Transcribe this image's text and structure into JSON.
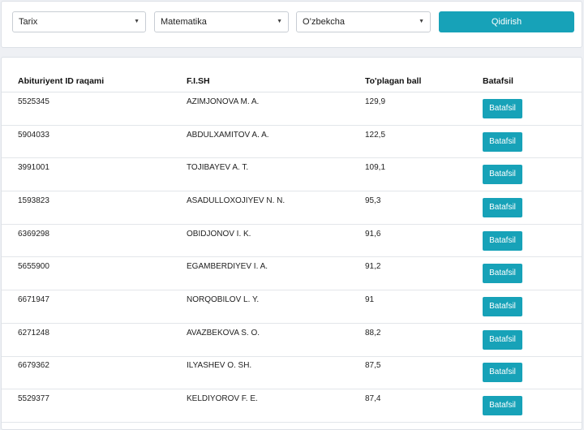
{
  "filters": {
    "subject1": "Tarix",
    "subject2": "Matematika",
    "language": "O’zbekcha",
    "search_label": "Qidirish"
  },
  "table": {
    "headers": [
      "Abituriyent ID raqami",
      "F.I.SH",
      "To'plagan ball",
      "Batafsil"
    ],
    "rows": [
      {
        "id": "5525345",
        "name": "AZIMJONOVA M. A.",
        "score": "129,9",
        "action": "Batafsil"
      },
      {
        "id": "5904033",
        "name": "ABDULXAMITOV A. A.",
        "score": "122,5",
        "action": "Batafsil"
      },
      {
        "id": "3991001",
        "name": "TOJIBAYEV A. T.",
        "score": "109,1",
        "action": "Batafsil"
      },
      {
        "id": "1593823",
        "name": "ASADULLOXOJIYEV N. N.",
        "score": "95,3",
        "action": "Batafsil"
      },
      {
        "id": "6369298",
        "name": "OBIDJONOV I. K.",
        "score": "91,6",
        "action": "Batafsil"
      },
      {
        "id": "5655900",
        "name": "EGAMBERDIYEV I. A.",
        "score": "91,2",
        "action": "Batafsil"
      },
      {
        "id": "6671947",
        "name": "NORQOBILOV L. Y.",
        "score": "91",
        "action": "Batafsil"
      },
      {
        "id": "6271248",
        "name": "AVAZBEKOVA S. O.",
        "score": "88,2",
        "action": "Batafsil"
      },
      {
        "id": "6679362",
        "name": "ILYASHEV O. SH.",
        "score": "87,5",
        "action": "Batafsil"
      },
      {
        "id": "5529377",
        "name": "KELDIYOROV F. E.",
        "score": "87,4",
        "action": "Batafsil"
      }
    ]
  },
  "colors": {
    "accent": "#17a2b8",
    "background": "#eef0f4"
  }
}
